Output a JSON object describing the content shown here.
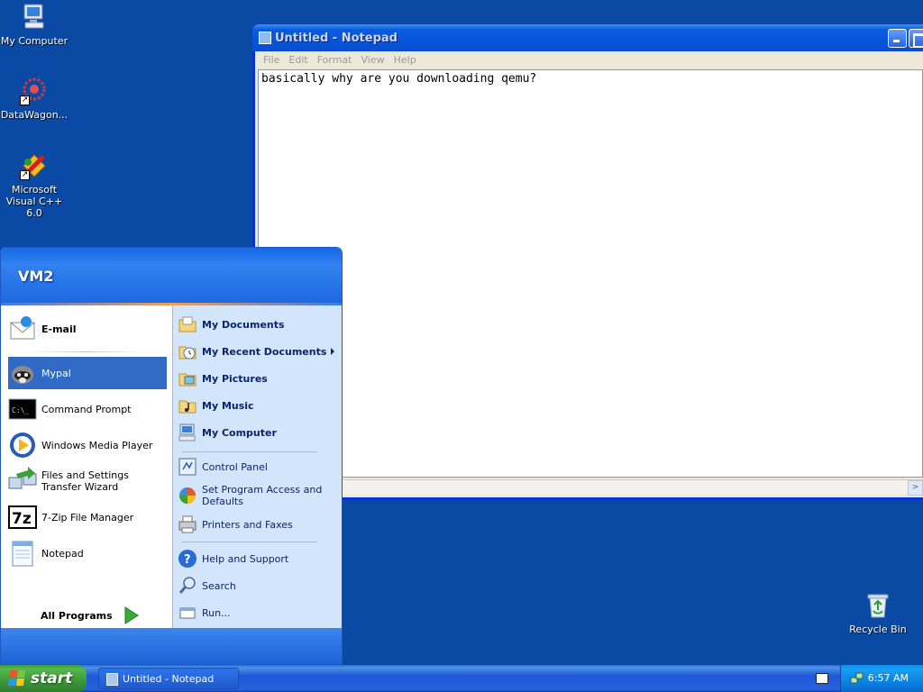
{
  "desktop": {
    "icons": [
      {
        "label": "My Computer"
      },
      {
        "label": "DataWagon..."
      },
      {
        "label": "Microsoft Visual C++ 6.0"
      },
      {
        "label": "Recycle Bin"
      }
    ]
  },
  "notepad": {
    "title": "Untitled - Notepad",
    "menu": [
      "File",
      "Edit",
      "Format",
      "View",
      "Help"
    ],
    "content": "basically why are you downloading qemu?"
  },
  "start_menu": {
    "user": "VM2",
    "pinned": [
      {
        "label": "E-mail",
        "icon": "email-icon"
      },
      {
        "label": "Mypal",
        "icon": "mypal-icon"
      },
      {
        "label": "Command Prompt",
        "icon": "command-prompt-icon"
      },
      {
        "label": "Windows Media Player",
        "icon": "media-player-icon"
      },
      {
        "label": "Files and Settings Transfer Wizard",
        "icon": "transfer-wizard-icon"
      },
      {
        "label": "7-Zip File Manager",
        "icon": "7zip-icon"
      },
      {
        "label": "Notepad",
        "icon": "notepad-icon"
      }
    ],
    "all_programs": "All Programs",
    "places": [
      {
        "label": "My Documents"
      },
      {
        "label": "My Recent Documents"
      },
      {
        "label": "My Pictures"
      },
      {
        "label": "My Music"
      },
      {
        "label": "My Computer"
      },
      {
        "label": "Control Panel"
      },
      {
        "label": "Set Program Access and Defaults"
      },
      {
        "label": "Printers and Faxes"
      },
      {
        "label": "Help and Support"
      },
      {
        "label": "Search"
      },
      {
        "label": "Run..."
      }
    ]
  },
  "taskbar": {
    "start": "start",
    "tasks": [
      {
        "label": "Untitled - Notepad"
      }
    ],
    "clock": "6:57 AM"
  },
  "colors": {
    "desktop": "#0a4aa5",
    "selection": "#316ac5",
    "start_green": "#3d973a",
    "taskbar_blue": "#2157d7",
    "tray_blue": "#0a7de0"
  }
}
